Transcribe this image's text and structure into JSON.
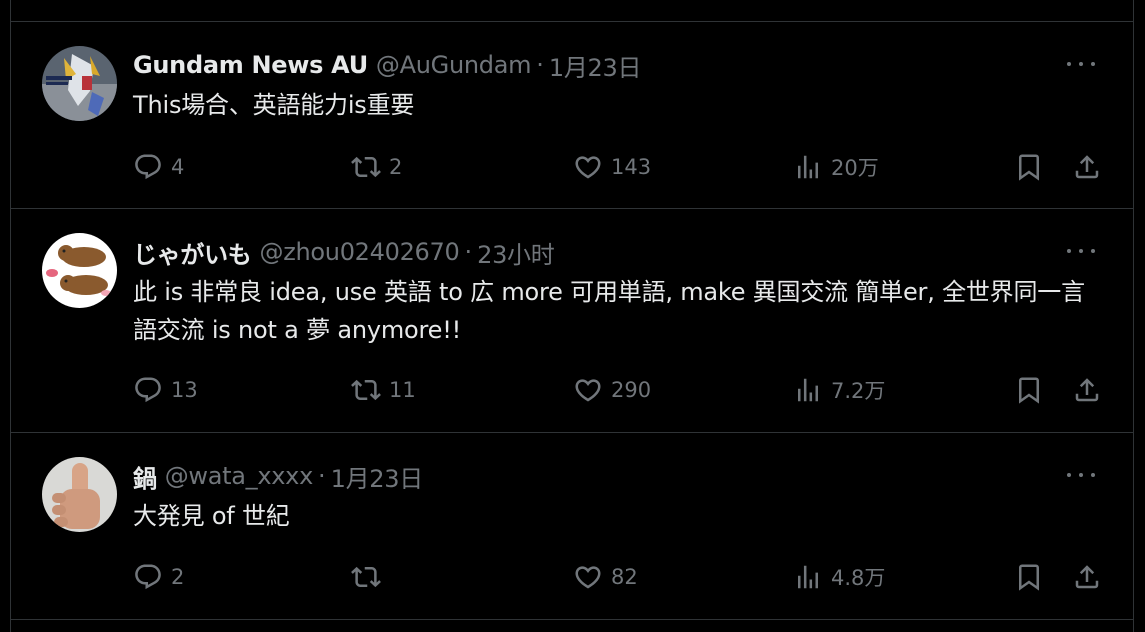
{
  "tweets": [
    {
      "name": "Gundam News AU",
      "handle": "@AuGundam",
      "separator": "·",
      "time": "1月23日",
      "text": "This場合、英語能力is重要",
      "replies": "4",
      "retweets": "2",
      "likes": "143",
      "views": "20万"
    },
    {
      "name": "じゃがいも",
      "handle": "@zhou02402670",
      "separator": "·",
      "time": "23小时",
      "text": "此 is 非常良 idea, use 英語 to 広 more 可用単語, make 異国交流 簡単er, 全世界同一言語交流 is not a 夢 anymore!!",
      "replies": "13",
      "retweets": "11",
      "likes": "290",
      "views": "7.2万"
    },
    {
      "name": "鍋",
      "handle": "@wata_xxxx",
      "separator": "·",
      "time": "1月23日",
      "text": "大発見 of 世紀",
      "replies": "2",
      "retweets": "",
      "likes": "82",
      "views": "4.8万"
    }
  ],
  "icons": [
    "avatar",
    "more-icon",
    "reply-icon",
    "retweet-icon",
    "like-icon",
    "views-icon",
    "bookmark-icon",
    "share-icon"
  ],
  "colors": {
    "background": "#000000",
    "text": "#e7e9ea",
    "muted": "#71767b",
    "divider": "#2f3336"
  }
}
